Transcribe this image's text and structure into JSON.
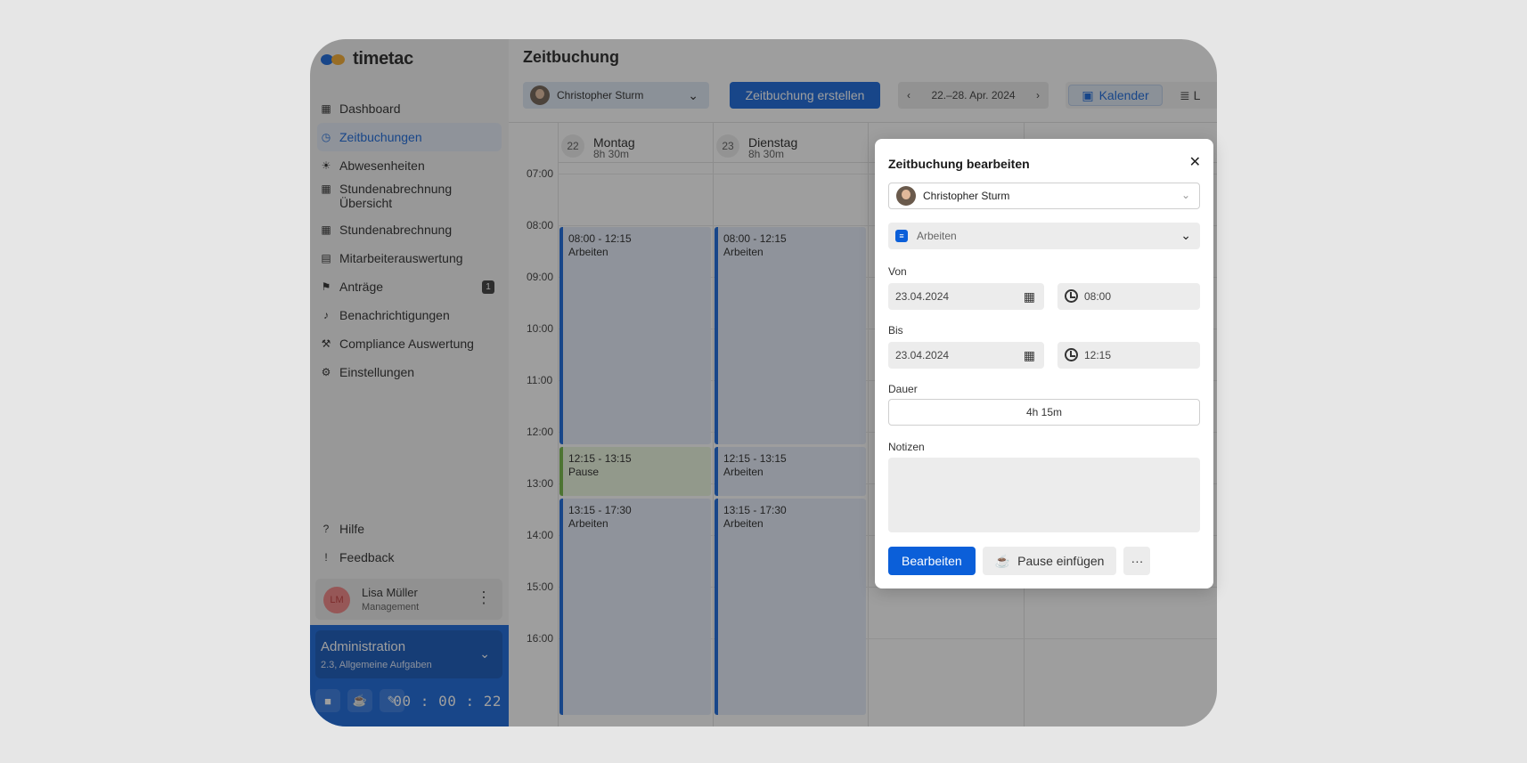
{
  "brand": {
    "name": "timetac"
  },
  "sidebar": {
    "items": [
      {
        "label": "Dashboard",
        "icon": "grid-icon"
      },
      {
        "label": "Zeitbuchungen",
        "icon": "stopwatch-icon",
        "active": true
      },
      {
        "label": "Abwesenheiten",
        "icon": "sun-icon"
      },
      {
        "label": "Stundenabrechnung Übersicht",
        "icon": "table-icon"
      },
      {
        "label": "Stundenabrechnung",
        "icon": "table-icon"
      },
      {
        "label": "Mitarbeiterauswertung",
        "icon": "document-icon"
      },
      {
        "label": "Anträge",
        "icon": "flag-icon",
        "badge": "1"
      },
      {
        "label": "Benachrichtigungen",
        "icon": "bell-icon"
      },
      {
        "label": "Compliance Auswertung",
        "icon": "gavel-icon"
      },
      {
        "label": "Einstellungen",
        "icon": "gear-icon"
      }
    ],
    "footer": [
      {
        "label": "Hilfe",
        "icon": "help-icon"
      },
      {
        "label": "Feedback",
        "icon": "feedback-icon"
      }
    ],
    "user": {
      "initials": "LM",
      "name": "Lisa Müller",
      "role": "Management"
    },
    "admin": {
      "title": "Administration",
      "subtitle": "2.3, Allgemeine Aufgaben",
      "timer": "00 : 00 : 22"
    }
  },
  "main": {
    "title": "Zeitbuchung",
    "employee": "Christopher Sturm",
    "create_label": "Zeitbuchung erstellen",
    "week_range": "22.–28. Apr. 2024",
    "view_calendar": "Kalender",
    "view_list": "L"
  },
  "calendar": {
    "days": [
      {
        "num": "22",
        "name": "Montag",
        "duration": "8h 30m"
      },
      {
        "num": "23",
        "name": "Dienstag",
        "duration": "8h 30m"
      }
    ],
    "hours": [
      "07:00",
      "08:00",
      "09:00",
      "10:00",
      "11:00",
      "12:00",
      "13:00",
      "14:00",
      "15:00",
      "16:00"
    ],
    "events": [
      {
        "day": 0,
        "time": "08:00 - 12:15",
        "label": "Arbeiten",
        "type": "work"
      },
      {
        "day": 0,
        "time": "12:15 - 13:15",
        "label": "Pause",
        "type": "pause"
      },
      {
        "day": 0,
        "time": "13:15 - 17:30",
        "label": "Arbeiten",
        "type": "work"
      },
      {
        "day": 1,
        "time": "08:00 - 12:15",
        "label": "Arbeiten",
        "type": "work"
      },
      {
        "day": 1,
        "time": "12:15 - 13:15",
        "label": "Arbeiten",
        "type": "work"
      },
      {
        "day": 1,
        "time": "13:15 - 17:30",
        "label": "Arbeiten",
        "type": "work"
      }
    ]
  },
  "modal": {
    "title": "Zeitbuchung bearbeiten",
    "employee": "Christopher Sturm",
    "type": "Arbeiten",
    "from_label": "Von",
    "from_date": "23.04.2024",
    "from_time": "08:00",
    "to_label": "Bis",
    "to_date": "23.04.2024",
    "to_time": "12:15",
    "duration_label": "Dauer",
    "duration": "4h 15m",
    "notes_label": "Notizen",
    "notes": "",
    "save_label": "Bearbeiten",
    "pause_label": "Pause einfügen",
    "more_label": "···"
  },
  "colors": {
    "accent": "#0b5fd9",
    "pause": "#6cb33b"
  }
}
